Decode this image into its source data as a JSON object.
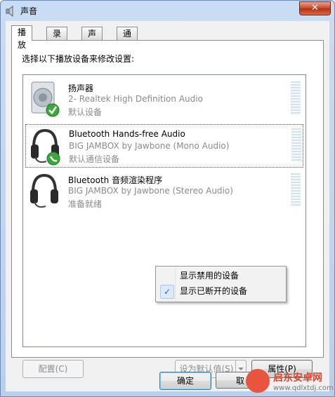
{
  "window": {
    "title": "声音",
    "close_symbol": "✕"
  },
  "tabs": [
    {
      "label": "播放",
      "active": true
    },
    {
      "label": "录制",
      "active": false
    },
    {
      "label": "声音",
      "active": false
    },
    {
      "label": "通信",
      "active": false
    }
  ],
  "instruction": "选择以下播放设备来修改设置:",
  "devices": [
    {
      "icon": "speaker-icon",
      "badge": "default-check-badge",
      "name": "扬声器",
      "description": "2- Realtek High Definition Audio",
      "status": "默认设备",
      "selected": false
    },
    {
      "icon": "headset-icon",
      "badge": "communication-phone-badge",
      "name": "Bluetooth Hands-free Audio",
      "description": "BIG JAMBOX by Jawbone (Mono Audio)",
      "status": "默认通信设备",
      "selected": true
    },
    {
      "icon": "headset-icon",
      "badge": "",
      "name": "Bluetooth 音频渲染程序",
      "description": "BIG JAMBOX by Jawbone (Stereo Audio)",
      "status": "准备就绪",
      "selected": false
    }
  ],
  "context_menu": {
    "items": [
      {
        "label": "显示禁用的设备",
        "checked": false
      },
      {
        "label": "显示已断开的设备",
        "checked": true
      }
    ],
    "check_symbol": "✓"
  },
  "buttons": {
    "configure": "配置(C)",
    "set_default": "设为默认值(S)",
    "properties": "属性(P)",
    "ok": "确定",
    "cancel_partial": "取"
  },
  "watermark": {
    "title": "启东安卓网",
    "url": "www.qdlxtdj.com"
  },
  "colors": {
    "selection_border": "#555555",
    "accent": "#3c7fb1",
    "watermark": "#d9442d"
  }
}
